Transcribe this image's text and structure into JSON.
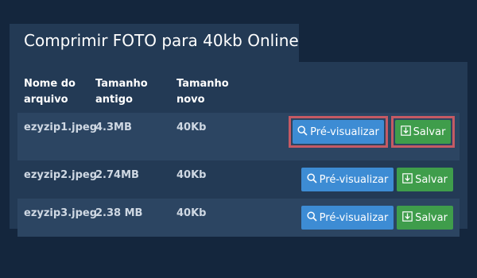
{
  "title": "Comprimir FOTO para 40kb Online",
  "columns": {
    "name": "Nome do\narquivo",
    "old_size": "Tamanho\nantigo",
    "new_size": "Tamanho\nnovo"
  },
  "rows": [
    {
      "name": "ezyzip1.jpeg",
      "old_size": "4.3MB",
      "new_size": "40Kb",
      "preview_label": "Pré-visualizar",
      "save_label": "Salvar"
    },
    {
      "name": "ezyzip2.jpeg",
      "old_size": "2.74MB",
      "new_size": "40Kb",
      "preview_label": "Pré-visualizar",
      "save_label": "Salvar"
    },
    {
      "name": "ezyzip3.jpeg",
      "old_size": "2.38 MB",
      "new_size": "40Kb",
      "preview_label": "Pré-visualizar",
      "save_label": "Salvar"
    }
  ],
  "icons": {
    "preview": "search-icon",
    "save": "download-icon"
  },
  "colors": {
    "background": "#14263d",
    "panel": "#233a55",
    "preview_button": "#3d8cd4",
    "save_button": "#3f9d4b",
    "highlight": "#c55a64"
  }
}
